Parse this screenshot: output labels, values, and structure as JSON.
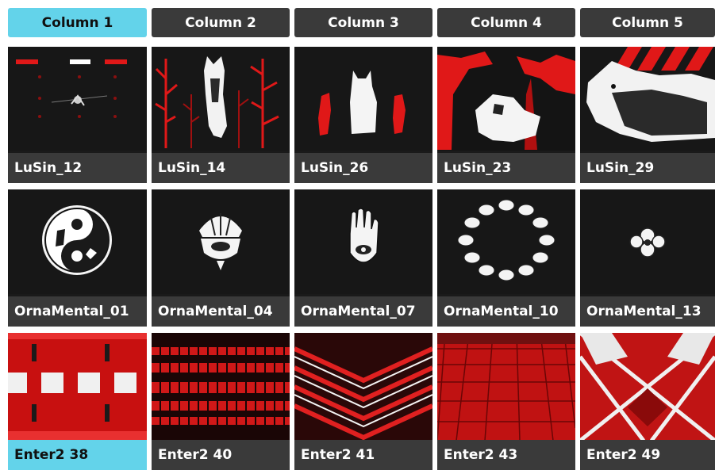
{
  "columns": [
    {
      "label": "Column 1",
      "active": true
    },
    {
      "label": "Column 2",
      "active": false
    },
    {
      "label": "Column 3",
      "active": false
    },
    {
      "label": "Column 4",
      "active": false
    },
    {
      "label": "Column 5",
      "active": false
    }
  ],
  "rows": [
    {
      "clips": [
        {
          "name": "LuSin_12",
          "thumb": "lusin-strobe"
        },
        {
          "name": "LuSin_14",
          "thumb": "lusin-trees"
        },
        {
          "name": "LuSin_26",
          "thumb": "lusin-figures"
        },
        {
          "name": "LuSin_23",
          "thumb": "lusin-forest"
        },
        {
          "name": "LuSin_29",
          "thumb": "lusin-wolf"
        }
      ]
    },
    {
      "clips": [
        {
          "name": "OrnaMental_01",
          "thumb": "yin-yang-ornament"
        },
        {
          "name": "OrnaMental_04",
          "thumb": "shell-ornament"
        },
        {
          "name": "OrnaMental_07",
          "thumb": "hamsa-ornament"
        },
        {
          "name": "OrnaMental_10",
          "thumb": "ring-ornament"
        },
        {
          "name": "OrnaMental_13",
          "thumb": "knot-ornament"
        }
      ]
    },
    {
      "clips": [
        {
          "name": "Enter2 38",
          "thumb": "red-blocks",
          "active": true
        },
        {
          "name": "Enter2 40",
          "thumb": "red-stripes"
        },
        {
          "name": "Enter2 41",
          "thumb": "red-chevrons"
        },
        {
          "name": "Enter2 43",
          "thumb": "red-grid-tunnel"
        },
        {
          "name": "Enter2 49",
          "thumb": "red-x-pattern"
        }
      ]
    }
  ],
  "colors": {
    "accent": "#63d3ea",
    "tile": "#3a3a3a",
    "clip_red": "#e01818"
  }
}
